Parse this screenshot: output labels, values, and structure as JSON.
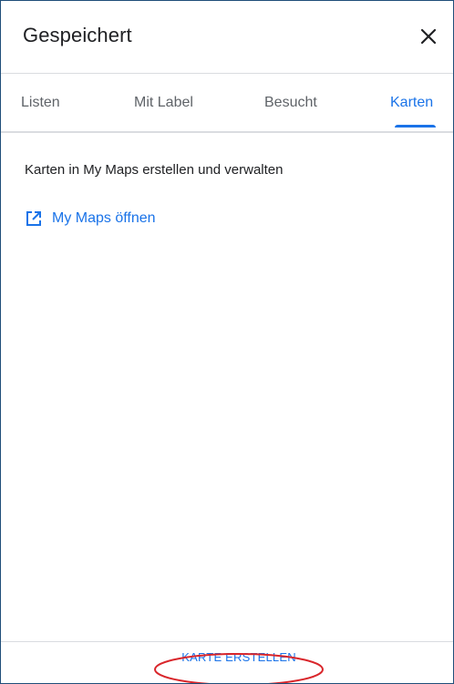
{
  "header": {
    "title": "Gespeichert"
  },
  "tabs": [
    {
      "label": "Listen",
      "active": false
    },
    {
      "label": "Mit Label",
      "active": false
    },
    {
      "label": "Besucht",
      "active": false
    },
    {
      "label": "Karten",
      "active": true
    }
  ],
  "content": {
    "description": "Karten in My Maps erstellen und verwalten",
    "link_label": "My Maps öffnen",
    "link_icon": "open-in-new-icon"
  },
  "footer": {
    "button_label": "KARTE ERSTELLEN"
  },
  "colors": {
    "accent": "#1a73e8",
    "text": "#202124",
    "muted": "#5f6368",
    "annotation": "#d9262b"
  }
}
